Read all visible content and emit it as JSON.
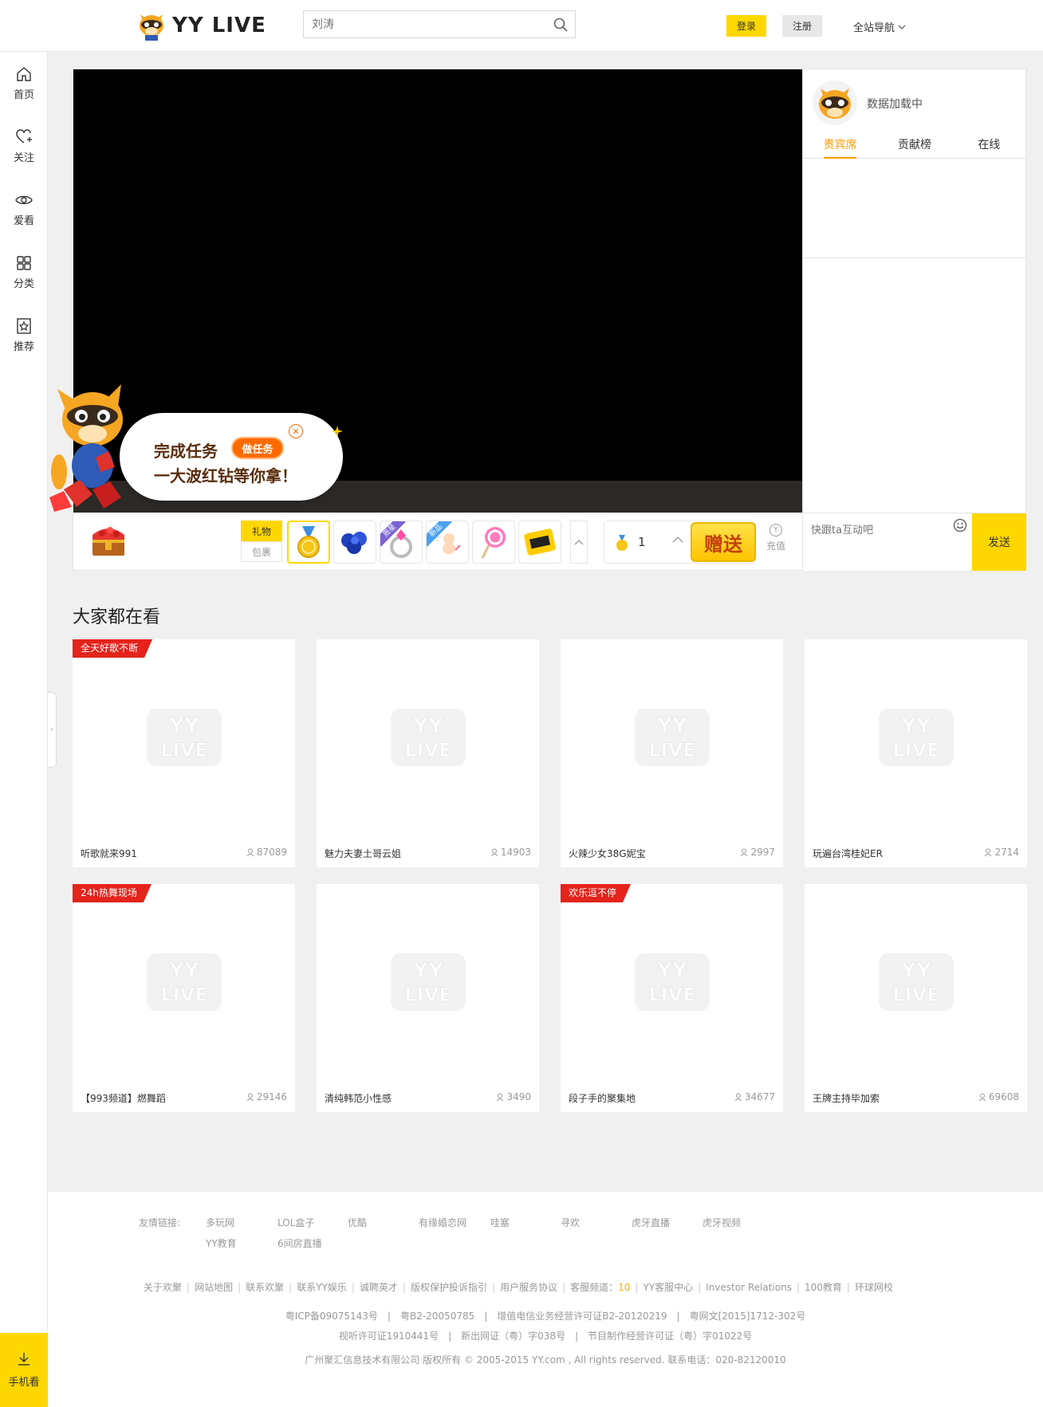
{
  "header": {
    "logo_text": "YY LIVE",
    "search_placeholder": "刘涛",
    "login": "登录",
    "register": "注册",
    "site_nav": "全站导航"
  },
  "sidebar": {
    "items": [
      {
        "label": "首页",
        "icon": "home-icon"
      },
      {
        "label": "关注",
        "icon": "heart-plus-icon"
      },
      {
        "label": "爱看",
        "icon": "eye-icon"
      },
      {
        "label": "分类",
        "icon": "grid-icon"
      },
      {
        "label": "推荐",
        "icon": "star-doc-icon"
      }
    ],
    "mobile_watch": "手机看"
  },
  "player": {
    "gift_tabs": [
      "礼物",
      "包裹"
    ],
    "gift_tags": [
      "周星",
      "新品"
    ],
    "quantity": "1",
    "send_gift": "赠送",
    "recharge": "充值",
    "recharge_icon": "Y"
  },
  "right_panel": {
    "anchor_name": "数据加载中",
    "tabs": [
      "贵宾席",
      "贡献榜",
      "在线"
    ],
    "chat_placeholder": "快跟ta互动吧",
    "send": "发送"
  },
  "promo": {
    "line1": "完成任务",
    "line2": "一大波红钻等你拿！",
    "button": "做任务"
  },
  "section": {
    "title": "大家都在看",
    "cards": [
      {
        "badge": "全天好歌不断",
        "title": "听歌就来991",
        "viewers": "87089"
      },
      {
        "badge": "",
        "title": "魅力夫妻土哥云姐",
        "viewers": "14903"
      },
      {
        "badge": "",
        "title": "火辣少女38G妮宝",
        "viewers": "2997"
      },
      {
        "badge": "",
        "title": "玩遍台湾桂妃ER",
        "viewers": "2714"
      },
      {
        "badge": "24h热舞现场",
        "title": "【993频道】燃舞蹈",
        "viewers": "29146"
      },
      {
        "badge": "",
        "title": "清纯韩范小性感",
        "viewers": "3490"
      },
      {
        "badge": "欢乐逗不停",
        "title": "段子手的聚集地",
        "viewers": "34677"
      },
      {
        "badge": "",
        "title": "王牌主持毕加索",
        "viewers": "69608"
      }
    ]
  },
  "footer": {
    "friend_label": "友情链接:",
    "friend_links": [
      "多玩网",
      "LOL盒子",
      "优酷",
      "有缘婚恋网",
      "哇塞",
      "寻欢",
      "虎牙直播",
      "虎牙视频",
      "YY教育",
      "6间房直播"
    ],
    "links": [
      "关于欢聚",
      "网站地图",
      "联系欢聚",
      "联系YY娱乐",
      "诚聘英才",
      "版权保护投诉指引",
      "用户服务协议",
      "客服频道：",
      "YY客服中心",
      "Investor Relations",
      "100教育",
      "环球网校"
    ],
    "service_channel_num": "10",
    "license1": "粤ICP备09075143号　|　粤B2-20050785　|　增值电信业务经营许可证B2-20120219　|　粤网文[2015]1712-302号",
    "license2": "视听许可证1910441号　|　新出网证（粤）字038号　|　节目制作经营许可证（粤）字01022号",
    "copyright": "广州聚汇信息技术有限公司 版权所有 © 2005-2015 YY.com , All rights reserved. 联系电话：020-82120010"
  },
  "colors": {
    "accent": "#ffd700",
    "badge_red": "#e4231b",
    "tab_active": "#ff9900"
  }
}
